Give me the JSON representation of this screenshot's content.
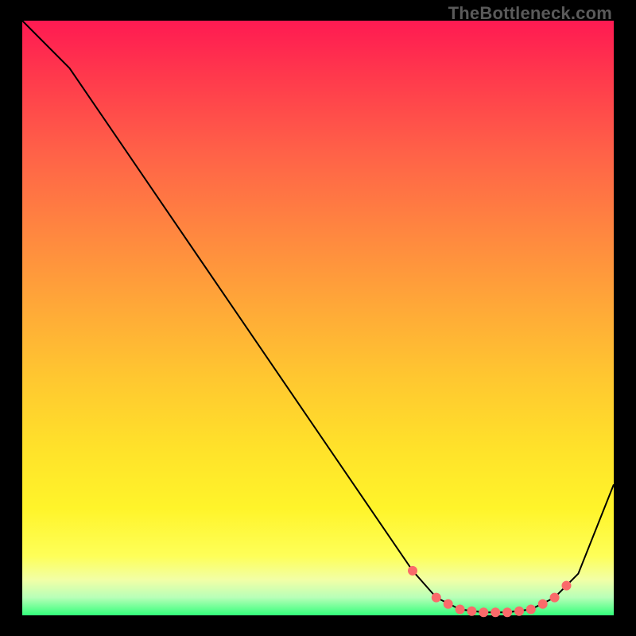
{
  "attribution": "TheBottleneck.com",
  "colors": {
    "background": "#000000",
    "curve_stroke": "#000000",
    "marker_fill": "#fa6a6a",
    "marker_stroke": "#fa6a6a"
  },
  "chart_data": {
    "type": "line",
    "title": "",
    "xlabel": "",
    "ylabel": "",
    "xlim": [
      0,
      100
    ],
    "ylim": [
      0,
      100
    ],
    "x": [
      0,
      8,
      66,
      70,
      74,
      78,
      82,
      86,
      90,
      94,
      100
    ],
    "values": [
      100,
      92,
      7.5,
      3.0,
      1.0,
      0.5,
      0.5,
      1.0,
      3.0,
      7.0,
      22
    ],
    "markers": {
      "x": [
        66,
        70,
        72,
        74,
        76,
        78,
        80,
        82,
        84,
        86,
        88,
        90,
        92
      ],
      "values": [
        7.5,
        3.0,
        1.9,
        1.0,
        0.7,
        0.5,
        0.5,
        0.5,
        0.7,
        1.0,
        1.9,
        3.0,
        5.0
      ]
    }
  }
}
